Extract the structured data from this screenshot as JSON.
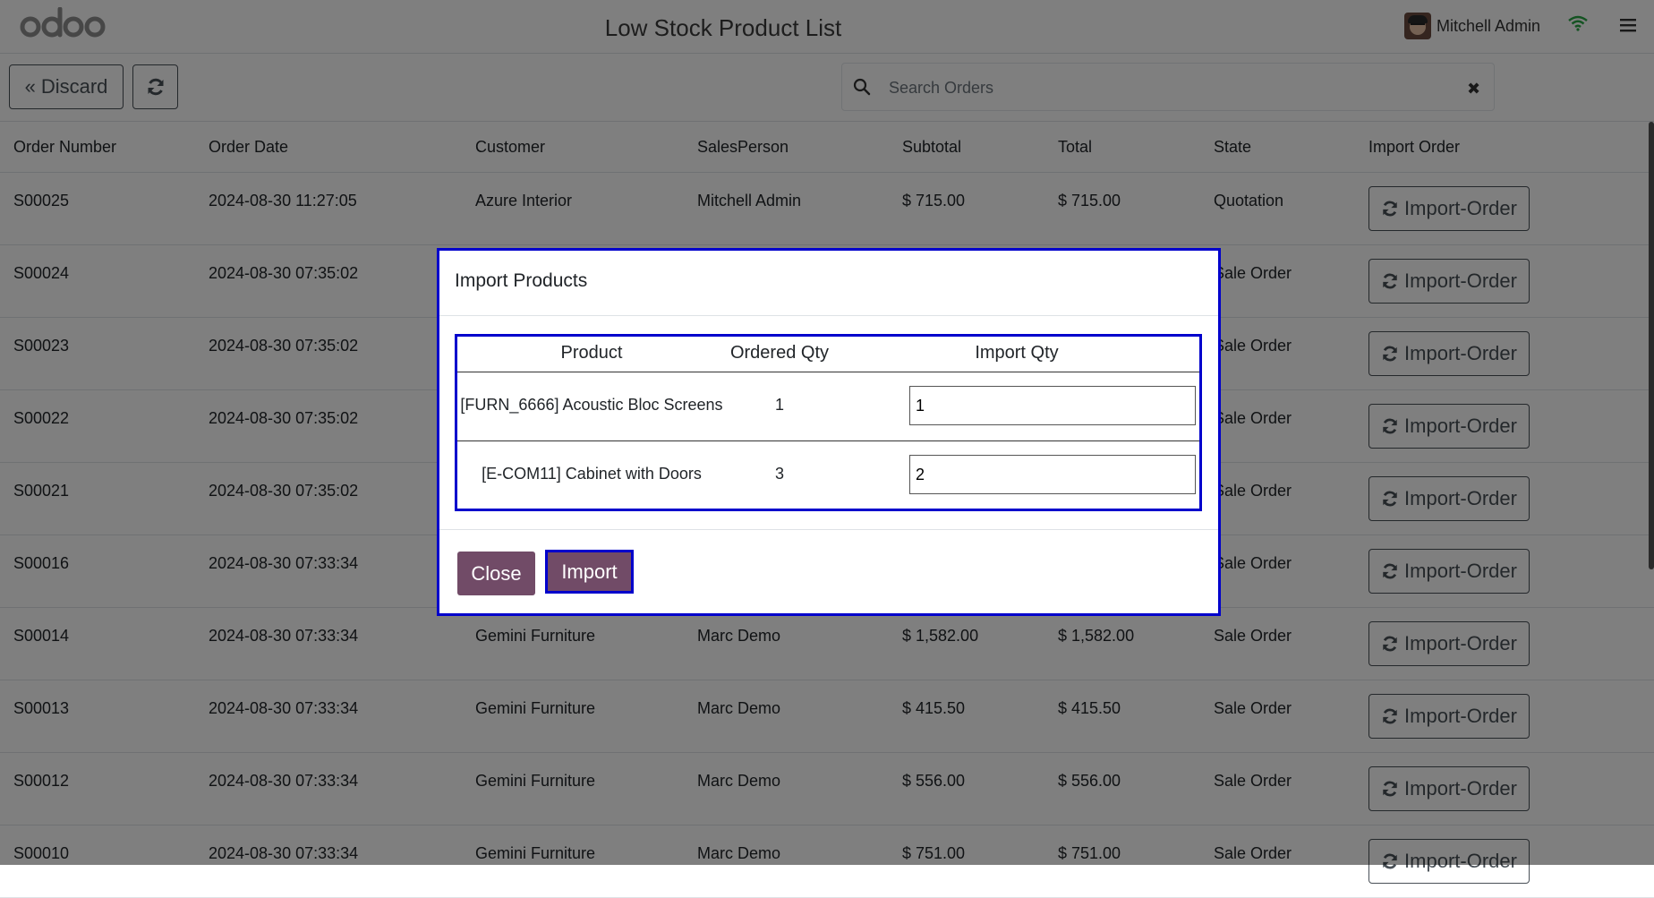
{
  "app": {
    "brand": "odoo",
    "title": "Low Stock Product List",
    "user_name": "Mitchell Admin"
  },
  "control": {
    "discard_label": "Discard",
    "search_placeholder": "Search Orders"
  },
  "table": {
    "columns": [
      "Order Number",
      "Order Date",
      "Customer",
      "SalesPerson",
      "Subtotal",
      "Total",
      "State",
      "Import Order"
    ],
    "import_button_label": "Import-Order",
    "rows": [
      {
        "number": "S00025",
        "date": "2024-08-30 11:27:05",
        "customer": "Azure Interior",
        "salesperson": "Mitchell Admin",
        "subtotal": "$ 715.00",
        "total": "$ 715.00",
        "state": "Quotation"
      },
      {
        "number": "S00024",
        "date": "2024-08-30 07:35:02",
        "customer": "",
        "salesperson": "",
        "subtotal": "",
        "total": "",
        "state": "Sale Order"
      },
      {
        "number": "S00023",
        "date": "2024-08-30 07:35:02",
        "customer": "",
        "salesperson": "",
        "subtotal": "",
        "total": "",
        "state": "Sale Order"
      },
      {
        "number": "S00022",
        "date": "2024-08-30 07:35:02",
        "customer": "",
        "salesperson": "",
        "subtotal": "",
        "total": "",
        "state": "Sale Order"
      },
      {
        "number": "S00021",
        "date": "2024-08-30 07:35:02",
        "customer": "",
        "salesperson": "",
        "subtotal": "",
        "total": "",
        "state": "Sale Order"
      },
      {
        "number": "S00016",
        "date": "2024-08-30 07:33:34",
        "customer": "",
        "salesperson": "",
        "subtotal": "",
        "total": "",
        "state": "Sale Order"
      },
      {
        "number": "S00014",
        "date": "2024-08-30 07:33:34",
        "customer": "Gemini Furniture",
        "salesperson": "Marc Demo",
        "subtotal": "$ 1,582.00",
        "total": "$ 1,582.00",
        "state": "Sale Order"
      },
      {
        "number": "S00013",
        "date": "2024-08-30 07:33:34",
        "customer": "Gemini Furniture",
        "salesperson": "Marc Demo",
        "subtotal": "$ 415.50",
        "total": "$ 415.50",
        "state": "Sale Order"
      },
      {
        "number": "S00012",
        "date": "2024-08-30 07:33:34",
        "customer": "Gemini Furniture",
        "salesperson": "Marc Demo",
        "subtotal": "$ 556.00",
        "total": "$ 556.00",
        "state": "Sale Order"
      },
      {
        "number": "S00010",
        "date": "2024-08-30 07:33:34",
        "customer": "Gemini Furniture",
        "salesperson": "Marc Demo",
        "subtotal": "$ 751.00",
        "total": "$ 751.00",
        "state": "Sale Order"
      }
    ]
  },
  "modal": {
    "title": "Import Products",
    "columns": [
      "Product",
      "Ordered Qty",
      "Import Qty"
    ],
    "lines": [
      {
        "product": "[FURN_6666] Acoustic Bloc Screens",
        "ordered_qty": "1",
        "import_qty": "1"
      },
      {
        "product": "[E-COM11] Cabinet with Doors",
        "ordered_qty": "3",
        "import_qty": "2"
      }
    ],
    "close_label": "Close",
    "import_label": "Import"
  },
  "colors": {
    "primary": "#714b67",
    "highlight_border": "#0000cc",
    "wifi": "#28a745"
  }
}
